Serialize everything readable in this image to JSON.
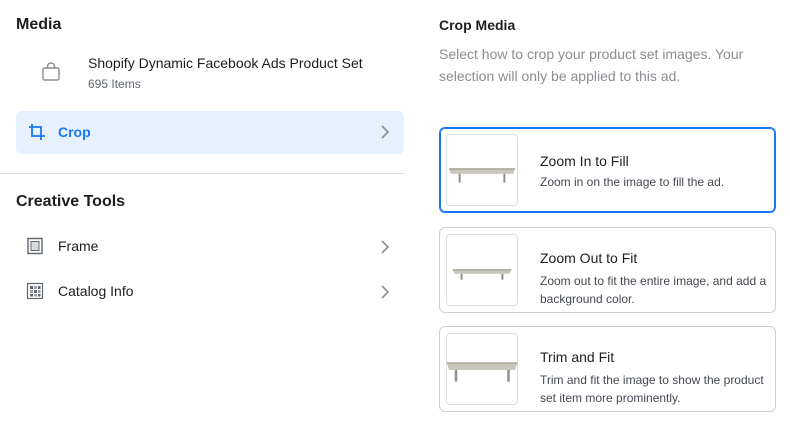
{
  "media": {
    "title": "Media",
    "product": {
      "name": "Shopify Dynamic Facebook Ads Product Set",
      "count": "695 Items",
      "icon": "shopping-bag-icon"
    },
    "crop": {
      "label": "Crop",
      "icon": "crop-icon",
      "selected": true
    }
  },
  "creative_tools": {
    "title": "Creative Tools",
    "items": [
      {
        "label": "Frame",
        "icon": "frame-icon"
      },
      {
        "label": "Catalog Info",
        "icon": "catalog-grid-icon"
      }
    ]
  },
  "crop_media": {
    "title": "Crop Media",
    "description": "Select how to crop your product set images. Your selection will only be applied to this ad.",
    "options": [
      {
        "title": "Zoom In to Fill",
        "description": "Zoom in on the image to fill the ad.",
        "selected": true
      },
      {
        "title": "Zoom Out to Fit",
        "description": "Zoom out to fit the entire image, and add a background color.",
        "selected": false
      },
      {
        "title": "Trim and Fit",
        "description": "Trim and fit the image to show the product set item more prominently.",
        "selected": false
      }
    ]
  },
  "colors": {
    "accent": "#1877f2",
    "selected_bg": "#e7f0fd",
    "border": "#ccd0d5"
  }
}
